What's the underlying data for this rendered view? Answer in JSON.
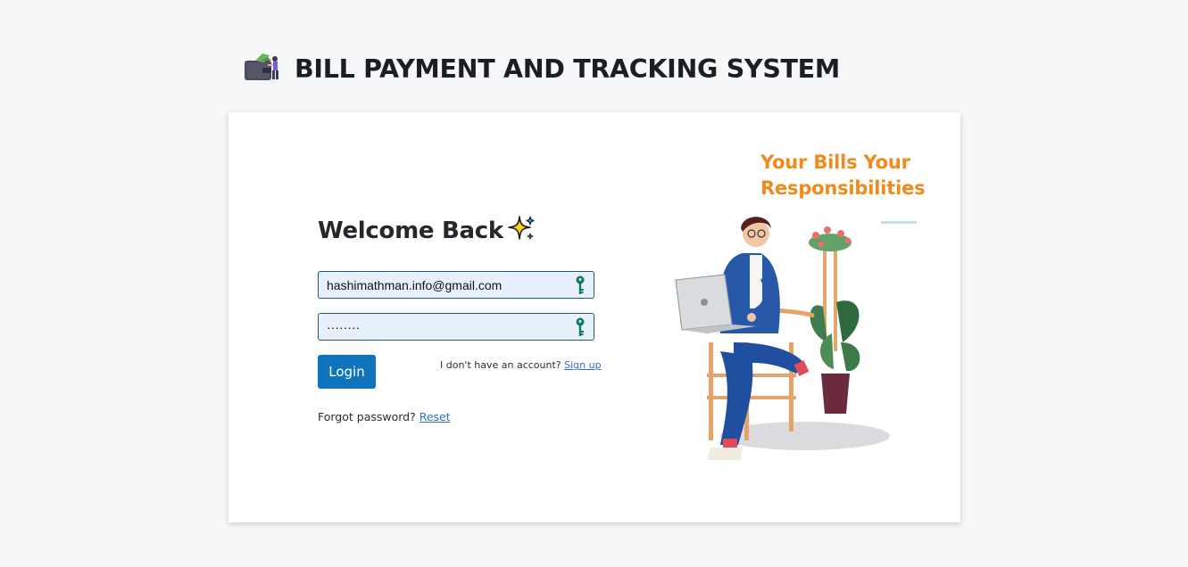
{
  "header": {
    "title": "BILL PAYMENT AND TRACKING SYSTEM",
    "logo_icon": "wallet-icon"
  },
  "login": {
    "welcome": "Welcome Back",
    "sparkle_icon": "sparkles-icon",
    "email_value": "hashimathman.info@gmail.com",
    "password_value": "········",
    "key_icon": "key-icon",
    "login_label": "Login",
    "no_account_text": "I don't have an account?",
    "signup_link": "Sign up",
    "forgot_text": "Forgot password?",
    "reset_link": "Reset"
  },
  "aside": {
    "tagline_line1": "Your Bills Your",
    "tagline_line2": "Responsibilities"
  },
  "colors": {
    "accent": "#0f74bb",
    "tagline": "#f08a1c",
    "input_bg": "#e8f0fe",
    "input_border": "#1f5b63",
    "key": "#0e7a5e"
  }
}
